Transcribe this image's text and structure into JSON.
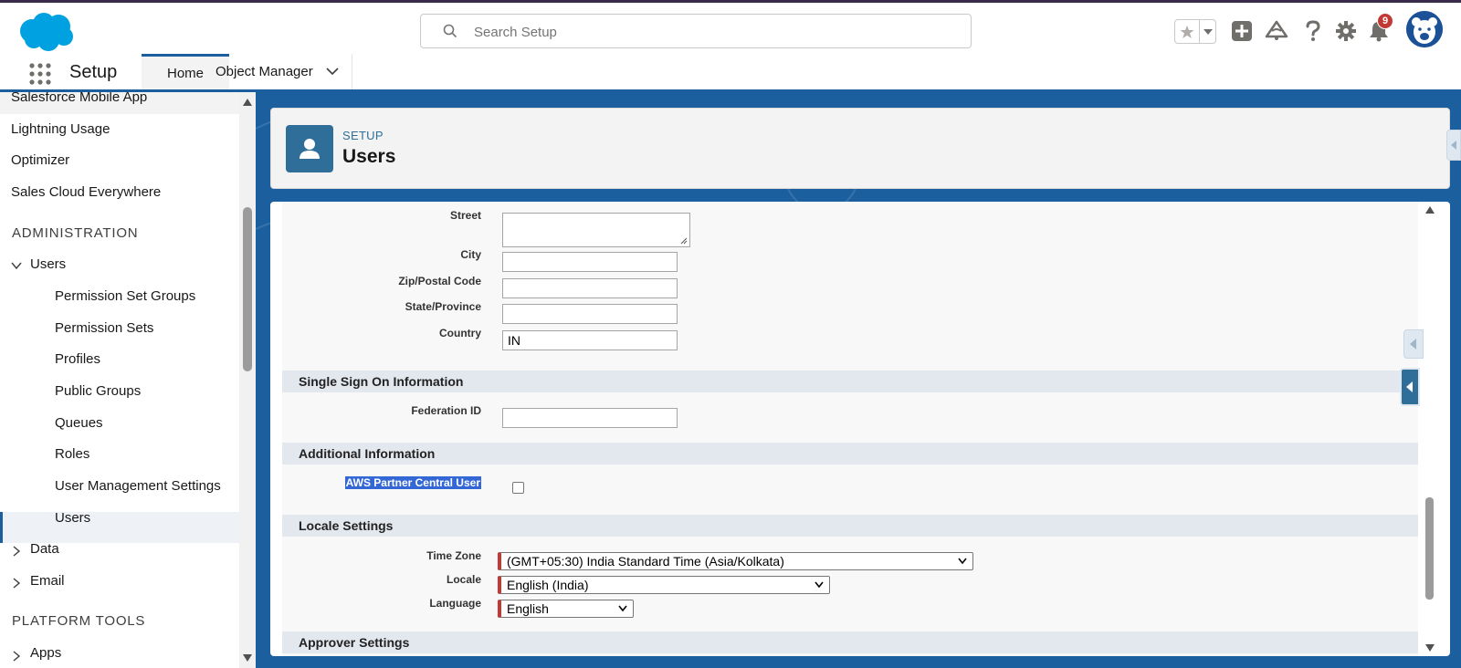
{
  "header": {
    "search_placeholder": "Search Setup",
    "notification_count": "9"
  },
  "nav": {
    "app_name": "Setup",
    "tabs": [
      {
        "label": "Home"
      },
      {
        "label": "Object Manager"
      }
    ]
  },
  "sidebar": {
    "items_top": [
      "Salesforce Mobile App",
      "Lightning Usage",
      "Optimizer",
      "Sales Cloud Everywhere"
    ],
    "section_admin": "ADMINISTRATION",
    "users_group": "Users",
    "users_children": [
      "Permission Set Groups",
      "Permission Sets",
      "Profiles",
      "Public Groups",
      "Queues",
      "Roles",
      "User Management Settings",
      "Users"
    ],
    "data": "Data",
    "email": "Email",
    "section_platform": "PLATFORM TOOLS",
    "apps": "Apps"
  },
  "page": {
    "eyebrow": "SETUP",
    "title": "Users"
  },
  "form": {
    "address": {
      "street_label": "Street",
      "city_label": "City",
      "zip_label": "Zip/Postal Code",
      "state_label": "State/Province",
      "country_label": "Country",
      "country_value": "IN"
    },
    "sso": {
      "heading": "Single Sign On Information",
      "federation_label": "Federation ID"
    },
    "additional": {
      "heading": "Additional Information",
      "aws_label": "AWS Partner Central User"
    },
    "locale": {
      "heading": "Locale Settings",
      "timezone_label": "Time Zone",
      "timezone_value": "(GMT+05:30) India Standard Time (Asia/Kolkata)",
      "locale_label": "Locale",
      "locale_value": "English (India)",
      "language_label": "Language",
      "language_value": "English"
    },
    "approver": {
      "heading": "Approver Settings"
    }
  },
  "colors": {
    "brand_blue": "#1b5f9e",
    "required_red": "#c23934",
    "header_icon": "#2e6e99"
  }
}
